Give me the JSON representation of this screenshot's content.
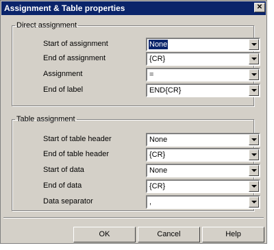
{
  "window": {
    "title": "Assignment & Table properties",
    "close_glyph": "✕"
  },
  "direct": {
    "legend": "Direct assignment",
    "rows": [
      {
        "label": "Start of assignment",
        "value": "None",
        "selected": true
      },
      {
        "label": "End of assignment",
        "value": "{CR}"
      },
      {
        "label": "Assignment",
        "value": "="
      },
      {
        "label": "End of label",
        "value": "END{CR}"
      }
    ]
  },
  "table": {
    "legend": "Table assignment",
    "rows": [
      {
        "label": "Start of table header",
        "value": "None"
      },
      {
        "label": "End of table header",
        "value": "{CR}"
      },
      {
        "label": "Start of data",
        "value": "None"
      },
      {
        "label": "End of data",
        "value": "{CR}"
      },
      {
        "label": "Data separator",
        "value": ","
      }
    ]
  },
  "buttons": {
    "ok": "OK",
    "cancel": "Cancel",
    "help": "Help"
  }
}
